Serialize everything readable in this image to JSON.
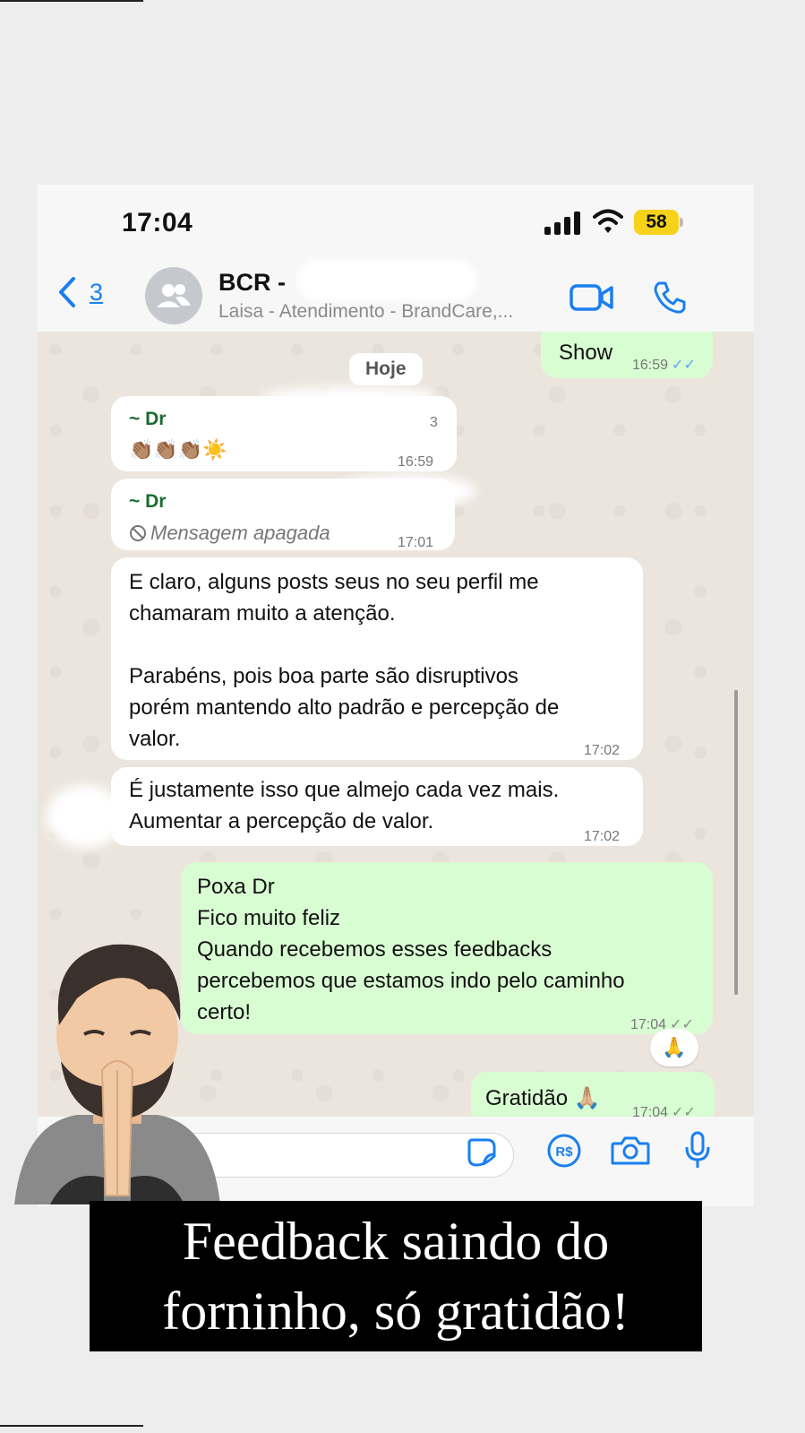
{
  "status_bar": {
    "time": "17:04",
    "battery": "58"
  },
  "header": {
    "back_count": "3",
    "title": "BCR -",
    "subtitle": "Laisa - Atendimento - BrandCare,..."
  },
  "chat": {
    "date_separator": "Hoje",
    "messages": [
      {
        "direction": "outgoing",
        "text": "Show",
        "time": "16:59"
      },
      {
        "direction": "incoming",
        "sender": "~ Dr",
        "count": "3",
        "text": "👏🏽👏🏽👏🏽☀️",
        "time": "16:59"
      },
      {
        "direction": "incoming",
        "sender": "~ Dr",
        "text": "Mensagem apagada",
        "time": "17:01"
      },
      {
        "direction": "incoming",
        "lines": [
          "E claro, alguns posts seus no seu perfil me",
          "chamaram muito a atenção.",
          "",
          "Parabéns, pois boa parte são disruptivos",
          "porém mantendo alto padrão e percepção de",
          "valor."
        ],
        "time": "17:02"
      },
      {
        "direction": "incoming",
        "lines": [
          "É justamente isso que almejo cada vez mais.",
          "Aumentar a percepção de valor."
        ],
        "time": "17:02"
      },
      {
        "direction": "outgoing",
        "lines": [
          "Poxa Dr",
          "Fico muito feliz",
          "Quando recebemos esses feedbacks",
          "percebemos que estamos indo pelo caminho",
          "certo!"
        ],
        "time": "17:04",
        "reaction": "🙏"
      },
      {
        "direction": "outgoing",
        "text": "Gratidão 🙏🏼",
        "time": "17:04"
      }
    ]
  },
  "caption": {
    "line1": "Feedback saindo do",
    "line2": "forninho, só gratidão!"
  },
  "colors": {
    "accent_blue": "#1a7ff0",
    "outgoing_bubble": "#d9fdd3",
    "chat_bg": "#ece5dd",
    "sender_green": "#1a6b2f",
    "battery_yellow": "#f7d21b"
  },
  "icons": [
    "signal-icon",
    "wifi-icon",
    "back-chevron-icon",
    "group-avatar-icon",
    "video-call-icon",
    "phone-call-icon",
    "deleted-icon",
    "sticker-icon",
    "pix-payment-icon",
    "camera-icon",
    "microphone-icon",
    "read-ticks-icon"
  ]
}
